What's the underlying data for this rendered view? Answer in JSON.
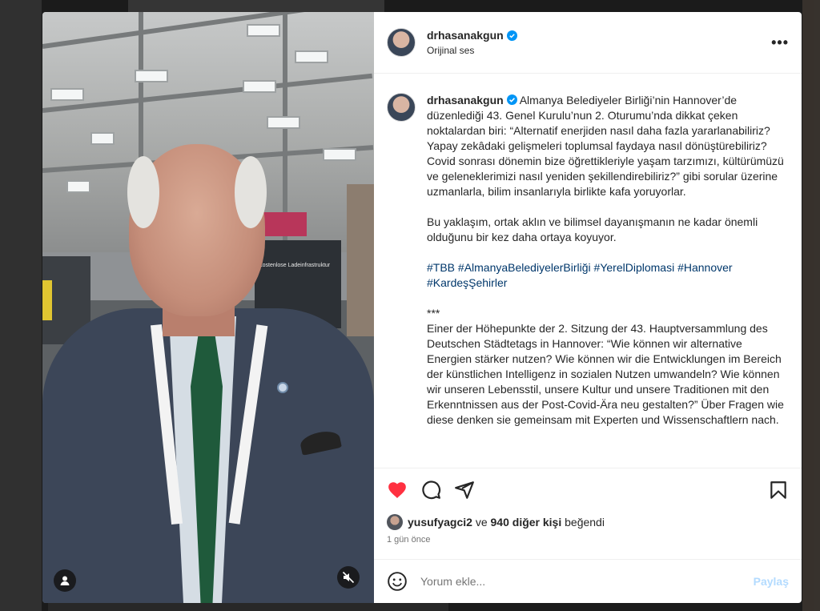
{
  "post": {
    "username": "drhasanakgun",
    "audio": "Orijinal ses",
    "caption_tr": "Almanya Belediyeler Birliği’nin Hannover’de düzenlediği 43. Genel Kurulu’nun 2. Oturumu’nda dikkat çeken noktalardan biri: “Alternatif enerjiden nasıl daha fazla yararlanabiliriz? Yapay zekâdaki gelişmeleri toplumsal faydaya nasıl dönüştürebiliriz? Covid sonrası dönemin bize öğrettikleriyle yaşam tarzımızı, kültürümüzü ve geleneklerimizi nasıl yeniden şekillendirebiliriz?” gibi sorular üzerine uzmanlarla, bilim insanlarıyla birlikte kafa yoruyorlar.",
    "caption_tr_2": "Bu yaklaşım, ortak aklın ve bilimsel dayanışmanın ne kadar önemli olduğunu bir kez daha ortaya koyuyor.",
    "hashtags": "#TBB #AlmanyaBelediyelerBirliği #YerelDiplomasi #Hannover #KardeşŞehirler",
    "separator": "***",
    "caption_de": "Einer der Höhepunkte der 2. Sitzung der 43. Hauptversammlung des Deutschen Städtetags in Hannover: “Wie können wir alternative Energien stärker nutzen? Wie können wir die Entwicklungen im Bereich der künstlichen Intelligenz in sozialen Nutzen umwandeln? Wie können wir unseren Lebensstil, unsere Kultur und unsere Traditionen mit den Erkenntnissen aus der Post-Covid-Ära neu gestalten?” Über Fragen wie diese denken sie gemeinsam mit Experten und Wissenschaftlern nach.",
    "likes_user": "yusufyagci2",
    "likes_connector": "ve",
    "likes_others": "940 diğer kişi",
    "likes_suffix": "beğendi",
    "time_ago": "1 gün önce"
  },
  "comment": {
    "placeholder": "Yorum ekle...",
    "post_label": "Paylaş"
  },
  "video": {
    "booth_sign": "Kostenlose Ladeinfrastruktur"
  },
  "colors": {
    "like_red": "#ff3040",
    "hashtag_blue": "#00376b",
    "verified_blue": "#0095f6",
    "post_disabled": "#b3dbff"
  },
  "icons": [
    "more-icon",
    "verified-icon",
    "heart-icon",
    "comment-icon",
    "share-icon",
    "bookmark-icon",
    "emoji-icon",
    "user-tag-icon",
    "mute-icon"
  ]
}
